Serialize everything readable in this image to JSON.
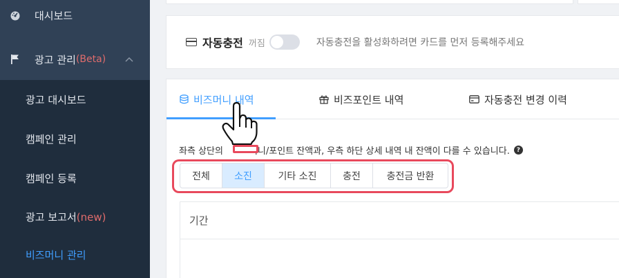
{
  "sidebar": {
    "dashboard": "대시보드",
    "ad_manage": "광고 관리",
    "ad_manage_badge": "(Beta)",
    "subitems": [
      {
        "label": "광고 대시보드"
      },
      {
        "label": "캠페인 관리"
      },
      {
        "label": "캠페인 등록"
      },
      {
        "label": "광고 보고서",
        "badge": "(new)"
      },
      {
        "label": "비즈머니 관리"
      }
    ]
  },
  "autocharge": {
    "title": "자동충전",
    "state": "꺼짐",
    "hint": "자동충전을 활성화하려면 카드를 먼저 등록해주세요"
  },
  "tabs": [
    {
      "label": "비즈머니 내역"
    },
    {
      "label": "비즈포인트 내역"
    },
    {
      "label": "자동충전 변경 이력"
    }
  ],
  "notice": {
    "text_before": "좌측 상단의",
    "text_after": "머니/포인트 잔액과, 우측 하단 상세 내역 내 잔액이 다를 수 있습니다.",
    "help": "?"
  },
  "filters": [
    {
      "label": "전체"
    },
    {
      "label": "소진"
    },
    {
      "label": "기타 소진"
    },
    {
      "label": "충전"
    },
    {
      "label": "충전금 반환"
    }
  ],
  "period": {
    "label": "기간"
  },
  "colors": {
    "accent": "#409eff",
    "highlight": "#e8495c",
    "sidebar": "#1f2d3d"
  }
}
